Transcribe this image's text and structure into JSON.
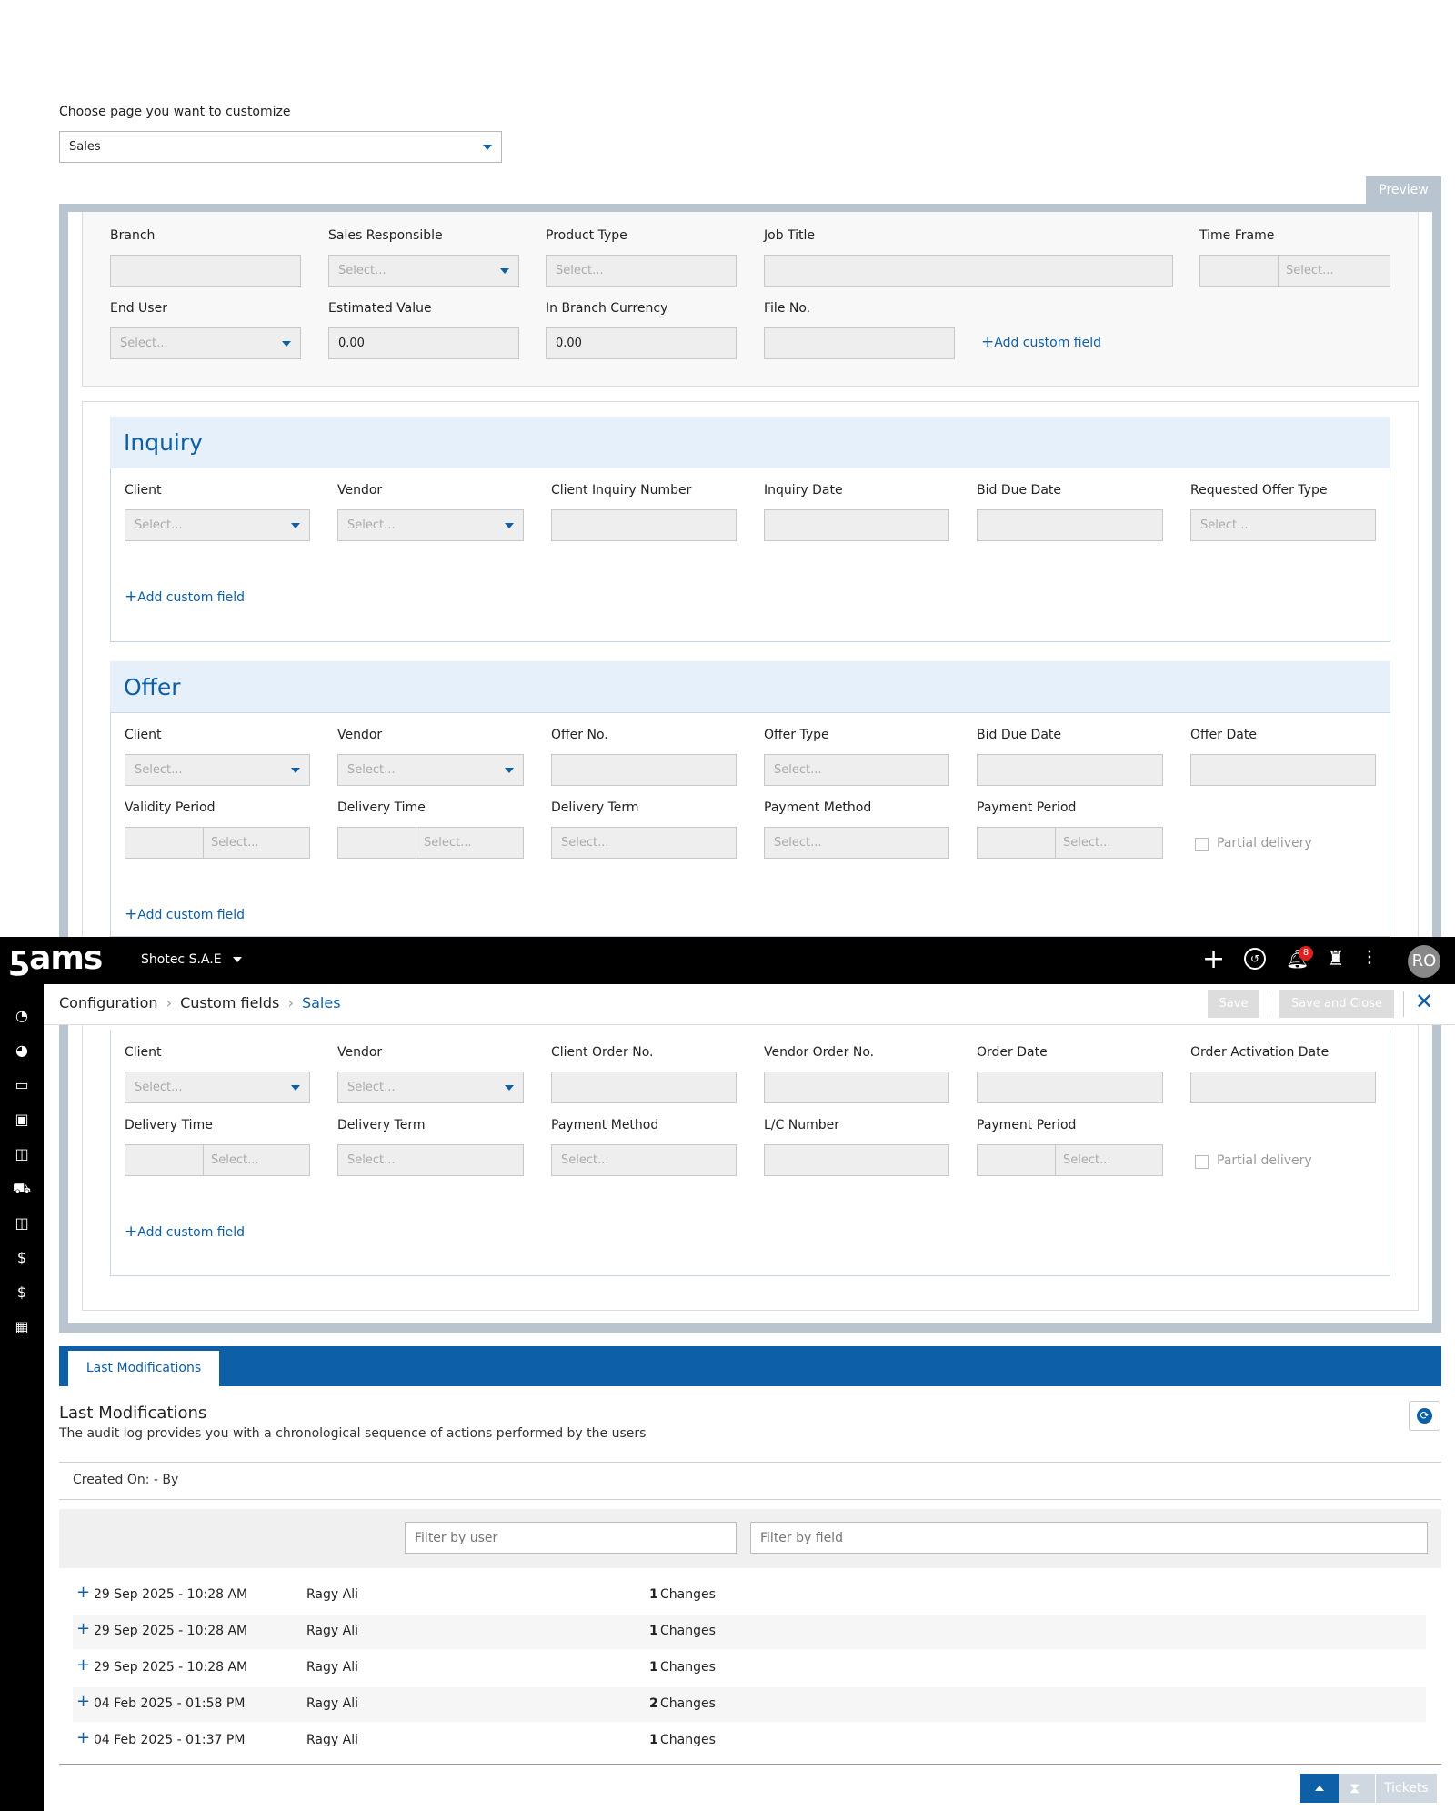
{
  "page_selector": {
    "label": "Choose page you want to customize",
    "value": "Sales"
  },
  "preview_tab": "Preview",
  "general": {
    "branch": "Branch",
    "sales_responsible": "Sales Responsible",
    "product_type": "Product Type",
    "job_title": "Job Title",
    "time_frame": "Time Frame",
    "end_user": "End User",
    "estimated_value": "Estimated Value",
    "in_branch_currency": "In Branch Currency",
    "file_no": "File No.",
    "estimated_value_val": "0.00",
    "in_branch_currency_val": "0.00"
  },
  "placeholders": {
    "select": "Select..."
  },
  "add_custom_field": "Add custom field",
  "inquiry": {
    "title": "Inquiry",
    "labels": [
      "Client",
      "Vendor",
      "Client Inquiry Number",
      "Inquiry Date",
      "Bid Due Date",
      "Requested Offer Type"
    ]
  },
  "offer": {
    "title": "Offer",
    "row1": [
      "Client",
      "Vendor",
      "Offer No.",
      "Offer Type",
      "Bid Due Date",
      "Offer Date"
    ],
    "row2": [
      "Validity Period",
      "Delivery Time",
      "Delivery Term",
      "Payment Method",
      "Payment Period"
    ],
    "partial_delivery": "Partial delivery"
  },
  "order": {
    "row1": [
      "Client",
      "Vendor",
      "Client Order No.",
      "Vendor Order No.",
      "Order Date",
      "Order Activation Date"
    ],
    "row2": [
      "Delivery Time",
      "Delivery Term",
      "Payment Method",
      "L/C Number",
      "Payment Period"
    ],
    "partial_delivery": "Partial delivery"
  },
  "topbar": {
    "logo": "ams",
    "company": "Shotec S.A.E",
    "notifications_count": "8",
    "avatar": "RO"
  },
  "breadcrumb": {
    "item1": "Configuration",
    "item2": "Custom fields",
    "item3": "Sales"
  },
  "actions": {
    "save": "Save",
    "save_close": "Save and Close"
  },
  "modifications": {
    "tab": "Last Modifications",
    "title": "Last Modifications",
    "subtitle": "The audit log provides you with a chronological sequence of actions performed by the users",
    "created": "Created On: - By",
    "filter_user_placeholder": "Filter by user",
    "filter_field_placeholder": "Filter by field",
    "changes_word": "Changes",
    "rows": [
      {
        "date": "29 Sep 2025 - 10:28 AM",
        "user": "Ragy Ali",
        "count": "1"
      },
      {
        "date": "29 Sep 2025 - 10:28 AM",
        "user": "Ragy Ali",
        "count": "1"
      },
      {
        "date": "29 Sep 2025 - 10:28 AM",
        "user": "Ragy Ali",
        "count": "1"
      },
      {
        "date": "04 Feb 2025 - 01:58 PM",
        "user": "Ragy Ali",
        "count": "2"
      },
      {
        "date": "04 Feb 2025 - 01:37 PM",
        "user": "Ragy Ali",
        "count": "1"
      }
    ]
  },
  "footer": {
    "tickets": "Tickets"
  }
}
